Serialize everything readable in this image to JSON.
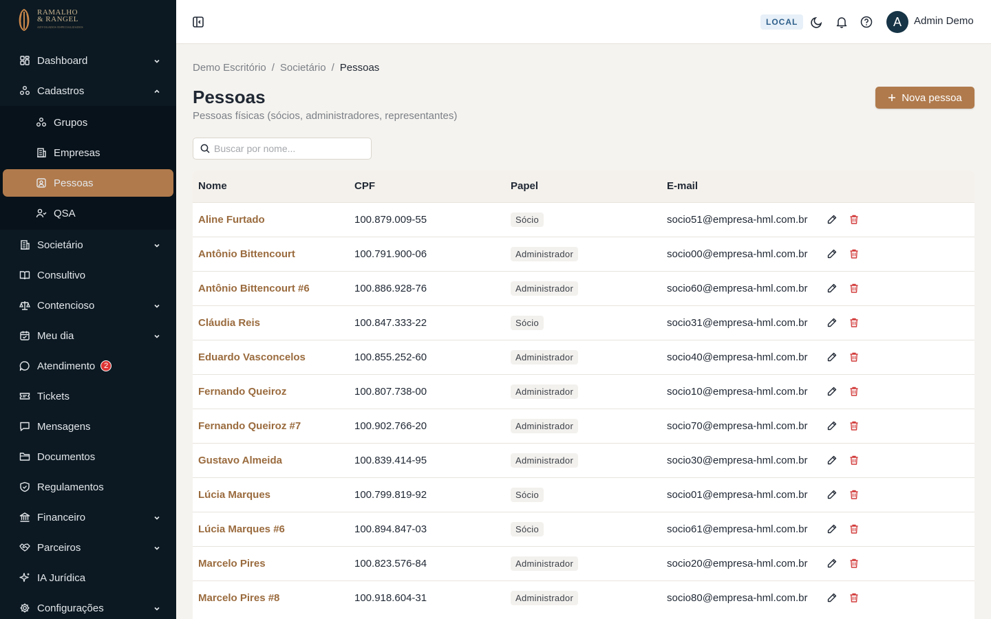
{
  "brand": {
    "line1": "RAMALHO",
    "line2": "& RANGEL",
    "tagline": "ADVOGADOS ESPECIALIZADOS"
  },
  "sidebar": {
    "items": [
      {
        "label": "Dashboard",
        "icon": "dashboard-icon",
        "chevron": "down"
      },
      {
        "label": "Cadastros",
        "icon": "cadastros-icon",
        "chevron": "up",
        "open": true,
        "children": [
          {
            "label": "Grupos",
            "icon": "groups-icon"
          },
          {
            "label": "Empresas",
            "icon": "building-icon"
          },
          {
            "label": "Pessoas",
            "icon": "person-card-icon",
            "active": true
          },
          {
            "label": "QSA",
            "icon": "user-check-icon"
          }
        ]
      },
      {
        "label": "Societário",
        "icon": "building-icon",
        "chevron": "down"
      },
      {
        "label": "Consultivo",
        "icon": "book-icon"
      },
      {
        "label": "Contencioso",
        "icon": "scale-icon",
        "chevron": "down"
      },
      {
        "label": "Meu dia",
        "icon": "calendar-icon",
        "chevron": "down"
      },
      {
        "label": "Atendimento",
        "icon": "chat-icon",
        "badge": "2"
      },
      {
        "label": "Tickets",
        "icon": "ticket-icon"
      },
      {
        "label": "Mensagens",
        "icon": "message-icon"
      },
      {
        "label": "Documentos",
        "icon": "folder-icon"
      },
      {
        "label": "Regulamentos",
        "icon": "shield-icon"
      },
      {
        "label": "Financeiro",
        "icon": "bank-icon",
        "chevron": "down"
      },
      {
        "label": "Parceiros",
        "icon": "handshake-icon",
        "chevron": "down"
      },
      {
        "label": "IA Jurídica",
        "icon": "sparkle-icon"
      },
      {
        "label": "Configurações",
        "icon": "gear-icon",
        "chevron": "down"
      }
    ]
  },
  "topbar": {
    "env": "LOCAL",
    "avatar_initial": "A",
    "user": "Admin Demo"
  },
  "breadcrumb": [
    "Demo Escritório",
    "Societário",
    "Pessoas"
  ],
  "page": {
    "title": "Pessoas",
    "subtitle": "Pessoas físicas (sócios, administradores, representantes)",
    "new_button": "Nova pessoa",
    "search_placeholder": "Buscar por nome..."
  },
  "table": {
    "columns": [
      "Nome",
      "CPF",
      "Papel",
      "E-mail"
    ],
    "rows": [
      {
        "nome": "Aline Furtado",
        "cpf": "100.879.009-55",
        "papel": "Sócio",
        "email": "socio51@empresa-hml.com.br"
      },
      {
        "nome": "Antônio Bittencourt",
        "cpf": "100.791.900-06",
        "papel": "Administrador",
        "email": "socio00@empresa-hml.com.br"
      },
      {
        "nome": "Antônio Bittencourt #6",
        "cpf": "100.886.928-76",
        "papel": "Administrador",
        "email": "socio60@empresa-hml.com.br"
      },
      {
        "nome": "Cláudia Reis",
        "cpf": "100.847.333-22",
        "papel": "Sócio",
        "email": "socio31@empresa-hml.com.br"
      },
      {
        "nome": "Eduardo Vasconcelos",
        "cpf": "100.855.252-60",
        "papel": "Administrador",
        "email": "socio40@empresa-hml.com.br"
      },
      {
        "nome": "Fernando Queiroz",
        "cpf": "100.807.738-00",
        "papel": "Administrador",
        "email": "socio10@empresa-hml.com.br"
      },
      {
        "nome": "Fernando Queiroz #7",
        "cpf": "100.902.766-20",
        "papel": "Administrador",
        "email": "socio70@empresa-hml.com.br"
      },
      {
        "nome": "Gustavo Almeida",
        "cpf": "100.839.414-95",
        "papel": "Administrador",
        "email": "socio30@empresa-hml.com.br"
      },
      {
        "nome": "Lúcia Marques",
        "cpf": "100.799.819-92",
        "papel": "Sócio",
        "email": "socio01@empresa-hml.com.br"
      },
      {
        "nome": "Lúcia Marques #6",
        "cpf": "100.894.847-03",
        "papel": "Sócio",
        "email": "socio61@empresa-hml.com.br"
      },
      {
        "nome": "Marcelo Pires",
        "cpf": "100.823.576-84",
        "papel": "Administrador",
        "email": "socio20@empresa-hml.com.br"
      },
      {
        "nome": "Marcelo Pires #8",
        "cpf": "100.918.604-31",
        "papel": "Administrador",
        "email": "socio80@empresa-hml.com.br"
      }
    ]
  },
  "colors": {
    "sidebar_bg": "#0c1922",
    "accent": "#b07a4c",
    "name_link": "#9a6b3e",
    "delete": "#d23b3b"
  }
}
